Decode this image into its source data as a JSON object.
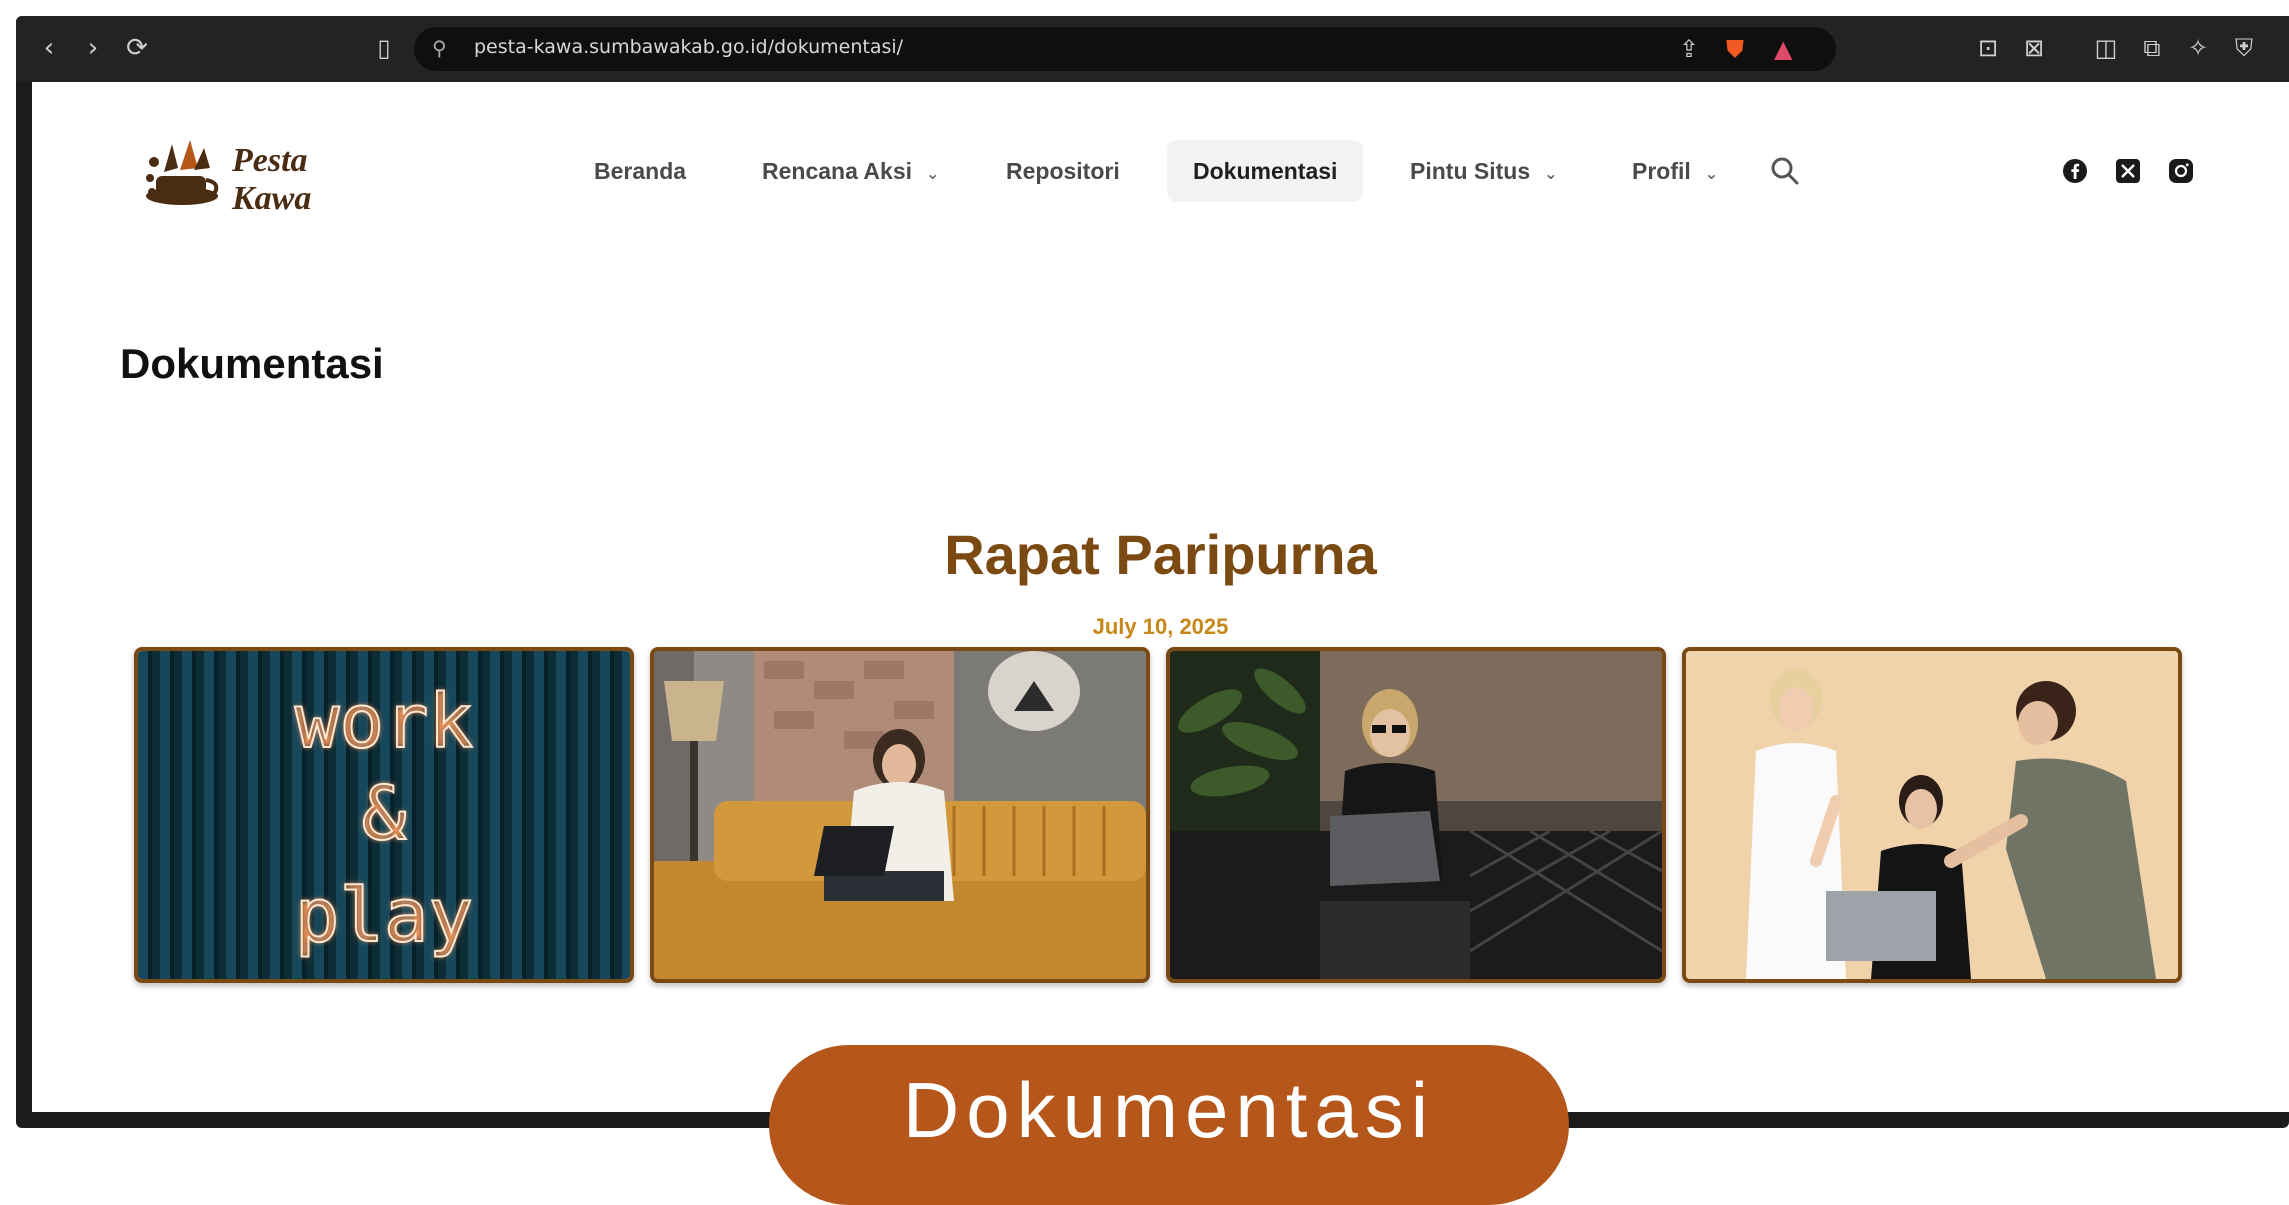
{
  "browser": {
    "url": "pesta-kawa.sumbawakab.go.id/dokumentasi/",
    "back_glyph": "‹",
    "forward_glyph": "›",
    "reload_glyph": "⟳"
  },
  "site": {
    "logo_line1": "Pesta",
    "logo_line2": "Kawa"
  },
  "nav": {
    "items": [
      {
        "label": "Beranda",
        "has_dropdown": false
      },
      {
        "label": "Rencana Aksi",
        "has_dropdown": true
      },
      {
        "label": "Repositori",
        "has_dropdown": false
      },
      {
        "label": "Dokumentasi",
        "has_dropdown": false,
        "active": true
      },
      {
        "label": "Pintu Situs",
        "has_dropdown": true
      },
      {
        "label": "Profil",
        "has_dropdown": true
      }
    ],
    "chevron_glyph": "⌄"
  },
  "social": {
    "icons": [
      "facebook-icon",
      "x-icon",
      "instagram-icon"
    ]
  },
  "page": {
    "title": "Dokumentasi"
  },
  "album": {
    "title": "Rapat Paripurna",
    "date": "July 10, 2025",
    "photos": [
      {
        "name": "neon-sign-photo",
        "neon_line1": "work",
        "neon_line2": "&",
        "neon_line3": "play"
      },
      {
        "name": "woman-laptop-sofa-photo"
      },
      {
        "name": "woman-glasses-laptop-photo"
      },
      {
        "name": "team-meeting-photo"
      }
    ]
  },
  "caption": {
    "label": "Dokumentasi"
  },
  "colors": {
    "brand_brown": "#7a4a12",
    "date_gold": "#c8871a",
    "pill_orange": "#b5561a"
  }
}
